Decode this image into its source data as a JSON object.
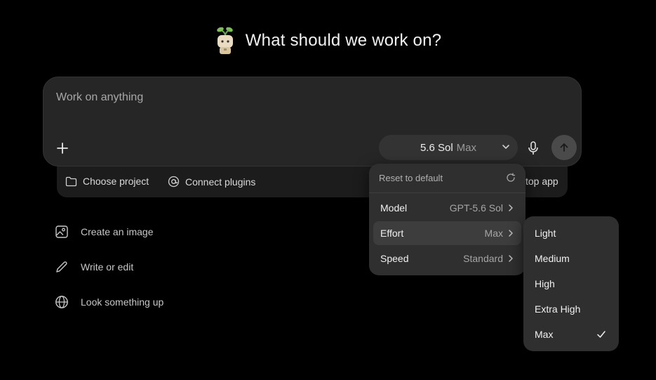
{
  "hero": {
    "title": "What should we work on?"
  },
  "composer": {
    "placeholder": "Work on anything",
    "model_name": "5.6 Sol",
    "model_effort": "Max"
  },
  "tray": {
    "choose_project": "Choose project",
    "connect_plugins": "Connect plugins",
    "right_partial": "top app"
  },
  "suggestions": [
    {
      "label": "Create an image",
      "icon": "image-icon"
    },
    {
      "label": "Write or edit",
      "icon": "pencil-icon"
    },
    {
      "label": "Look something up",
      "icon": "globe-icon"
    }
  ],
  "menu": {
    "reset_label": "Reset to default",
    "rows": [
      {
        "label": "Model",
        "value": "GPT-5.6 Sol"
      },
      {
        "label": "Effort",
        "value": "Max"
      },
      {
        "label": "Speed",
        "value": "Standard"
      }
    ]
  },
  "effort_submenu": {
    "options": [
      "Light",
      "Medium",
      "High",
      "Extra High",
      "Max"
    ],
    "selected": "Max"
  },
  "colors": {
    "background": "#000000",
    "composer": "#262626",
    "menu": "#2f2f2f"
  }
}
